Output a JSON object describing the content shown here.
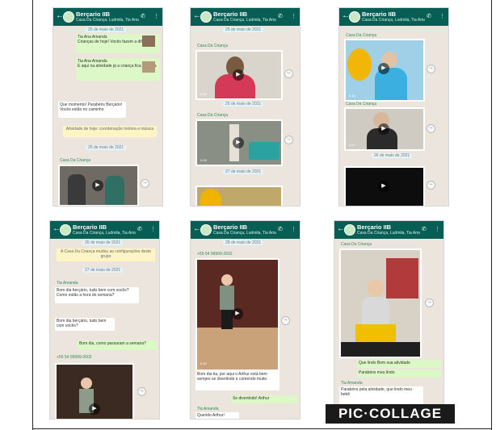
{
  "chat": {
    "title": "Berçario IIB",
    "subtitle": "Casa Da Criança, Ludmila, Tia Amanda..."
  },
  "icons": {
    "back": "arrow-left-icon",
    "call": "phone-icon",
    "menu": "more-vertical-icon",
    "play": "play-icon",
    "share": "forward-icon",
    "avatar": "group-avatar"
  },
  "colors": {
    "header": "#075e54",
    "outgoing": "#dcf8c6",
    "incoming": "#ffffff",
    "background": "#ece5dd"
  },
  "glyphs": {
    "back": "←",
    "call": "✆",
    "menu": "⋮",
    "play": "▶",
    "share": "↪"
  },
  "panels": [
    {
      "date": "25 de maio de 2021",
      "msg1": "Tia Ana Amanda",
      "msg2": "Crianças de hoje! Vocês fazem a diferença",
      "msg3": "Tia Ana Amanda",
      "msg4": "E aqui na atividade já a criança fica colorida",
      "msg5": "Que momento! Parabéns Berçário! Vocês estão no caminho",
      "sys": "Atividade de hoje: coordenação motora e música",
      "date2": "25 de maio de 2021",
      "sender": "Casa Da Criança"
    },
    {
      "date": "25 de maio de 2021",
      "sender1": "Casa Da Criança",
      "dur1": "0:09",
      "date2": "25 de maio de 2021",
      "sender2": "Casa Da Criança",
      "dur2": "0:18",
      "date3": "27 de maio de 2021"
    },
    {
      "sender1": "Casa Da Criança",
      "dur1": "0:14",
      "sender2": "Casa Da Criança",
      "dur2": "0:07",
      "date": "26 de maio de 2021"
    },
    {
      "date": "26 de maio de 2021",
      "sys": "A Casa Da Criança mudou as configurações deste grupo",
      "date2": "27 de maio de 2021",
      "sender1": "Tia Amanda",
      "msg1": "Bom dia berçário, tudo bem com vocês?",
      "msg2": "Como estão a hora de semana?",
      "msg3": "Bom dia berçário, tudo bem com vocês?",
      "out1": "Bom dia, como passaram a semana?",
      "sender2": "+55 54 99999-2602"
    },
    {
      "date": "28 de maio de 2021",
      "sender1": "+55 54 99999-2602",
      "msg1": "Bom dia tia, por aqui o Arthur está bem sempre se divertindo e comendo muito",
      "out1": "Se divertindo! Arthur",
      "sender2": "Tia Amanda",
      "msg2": "Querido Arthur!",
      "dur1": "0:20"
    },
    {
      "sender1": "Casa Da Criança",
      "msg1": "Que lindo Bom sua atividade",
      "out1": "Parabéns meu lindo",
      "sender2": "Tia Amanda",
      "msg2": "Parabéns pela atividade, que lindo meu bebê"
    }
  ],
  "watermark": "PIC·COLLAGE"
}
